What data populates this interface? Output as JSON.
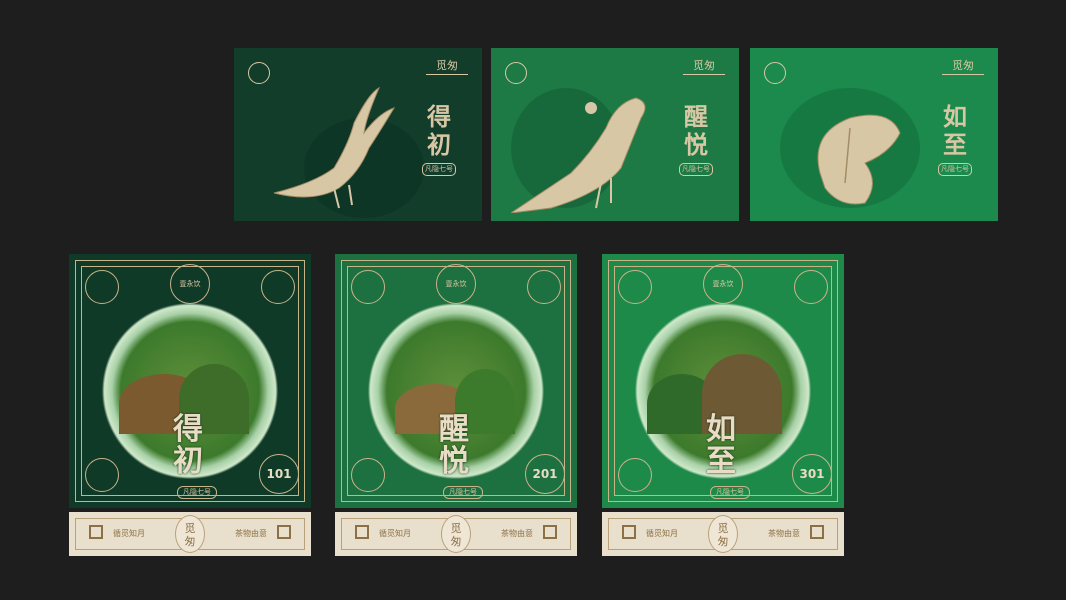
{
  "colors": {
    "background": "#1e1e1e",
    "gold": "#d8c7a5",
    "dark_green": "#123d2b",
    "mid_green": "#1d7a45",
    "bright_green": "#1b8a4c",
    "strip_cream": "#e9dfcd"
  },
  "top_tiles": [
    {
      "title_l1": "得",
      "title_l2": "初",
      "tag": "凡隐七号",
      "brand": "觅匆",
      "figure": "bird-icon"
    },
    {
      "title_l1": "醒",
      "title_l2": "悦",
      "tag": "凡隐七号",
      "brand": "觅匆",
      "figure": "bird-icon"
    },
    {
      "title_l1": "如",
      "title_l2": "至",
      "tag": "凡隐七号",
      "brand": "觅匆",
      "figure": "butterfly-icon"
    }
  ],
  "packs": [
    {
      "title_l1": "得",
      "title_l2": "初",
      "tag": "凡隐七号",
      "number": "101",
      "emblem": "壹永饮",
      "strip_left": "循觅知月",
      "strip_right": "茶物由意",
      "strip_logo_l1": "觅",
      "strip_logo_l2": "匆"
    },
    {
      "title_l1": "醒",
      "title_l2": "悦",
      "tag": "凡隐七号",
      "number": "201",
      "emblem": "壹永饮",
      "strip_left": "循觅知月",
      "strip_right": "茶物由意",
      "strip_logo_l1": "觅",
      "strip_logo_l2": "匆"
    },
    {
      "title_l1": "如",
      "title_l2": "至",
      "tag": "凡隐七号",
      "number": "301",
      "emblem": "壹永饮",
      "strip_left": "循觅知月",
      "strip_right": "茶物由意",
      "strip_logo_l1": "觅",
      "strip_logo_l2": "匆"
    }
  ]
}
